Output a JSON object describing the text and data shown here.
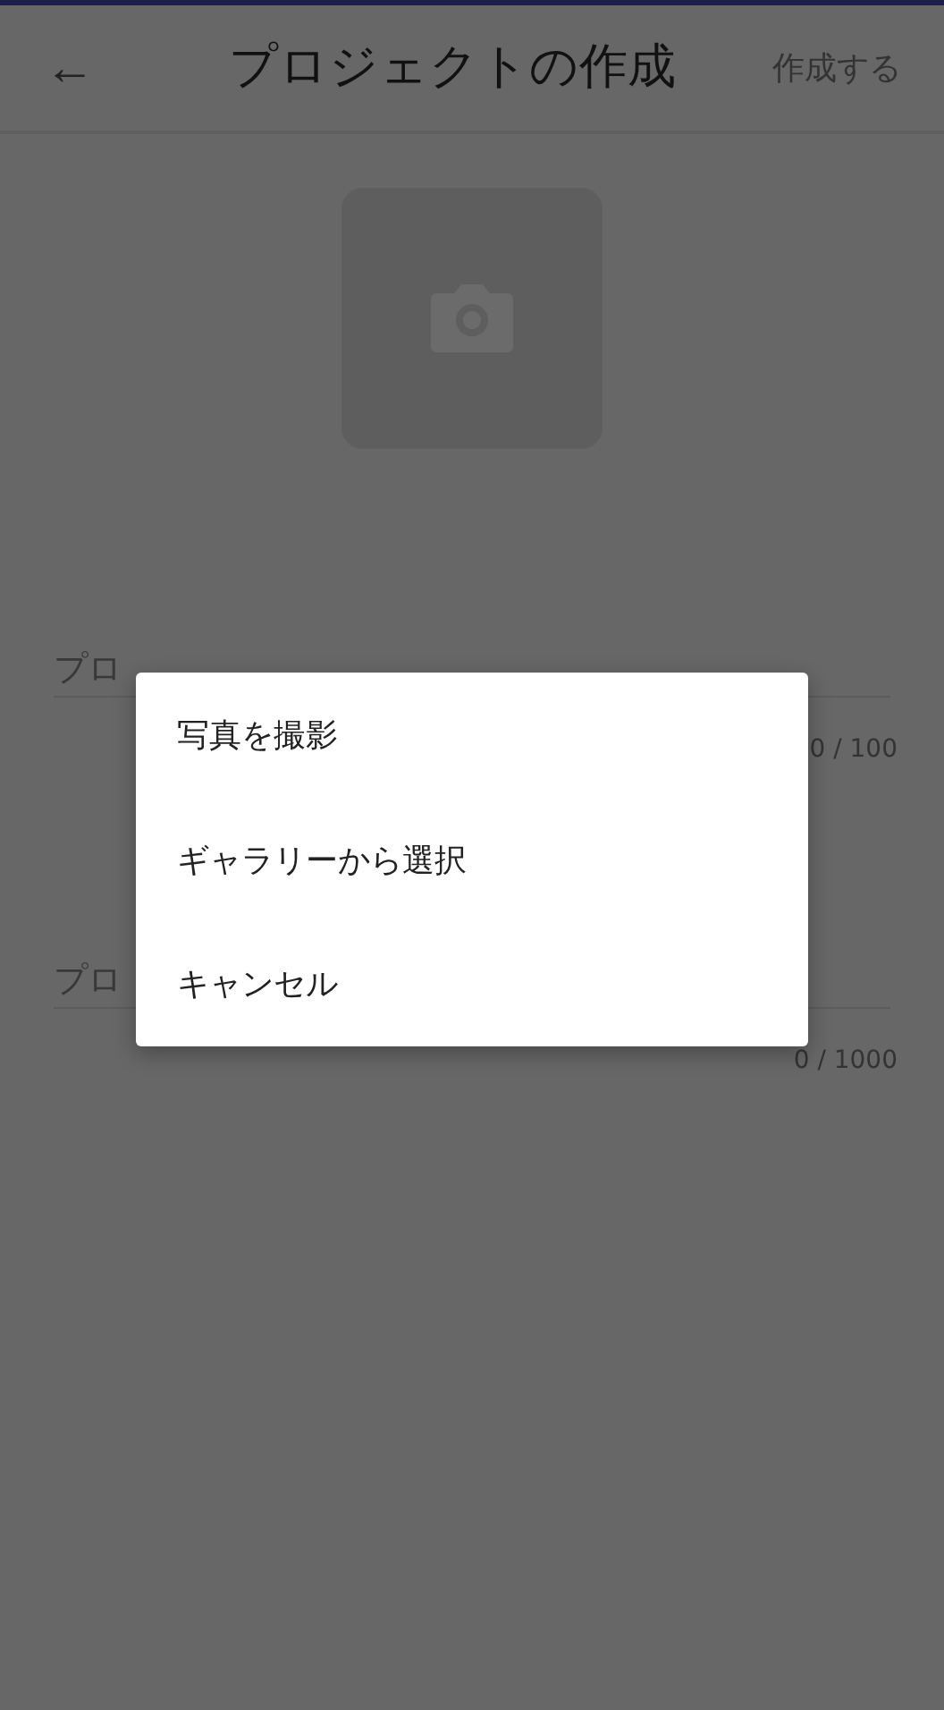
{
  "header": {
    "back": "←",
    "title": "プロジェクトの作成",
    "action": "作成する"
  },
  "fields": [
    {
      "label": "プロ",
      "counter": "0 / 100"
    },
    {
      "label": "プロ",
      "counter": "0 / 1000"
    }
  ],
  "dialog": {
    "items": [
      "写真を撮影",
      "ギャラリーから選択",
      "キャンセル"
    ]
  }
}
